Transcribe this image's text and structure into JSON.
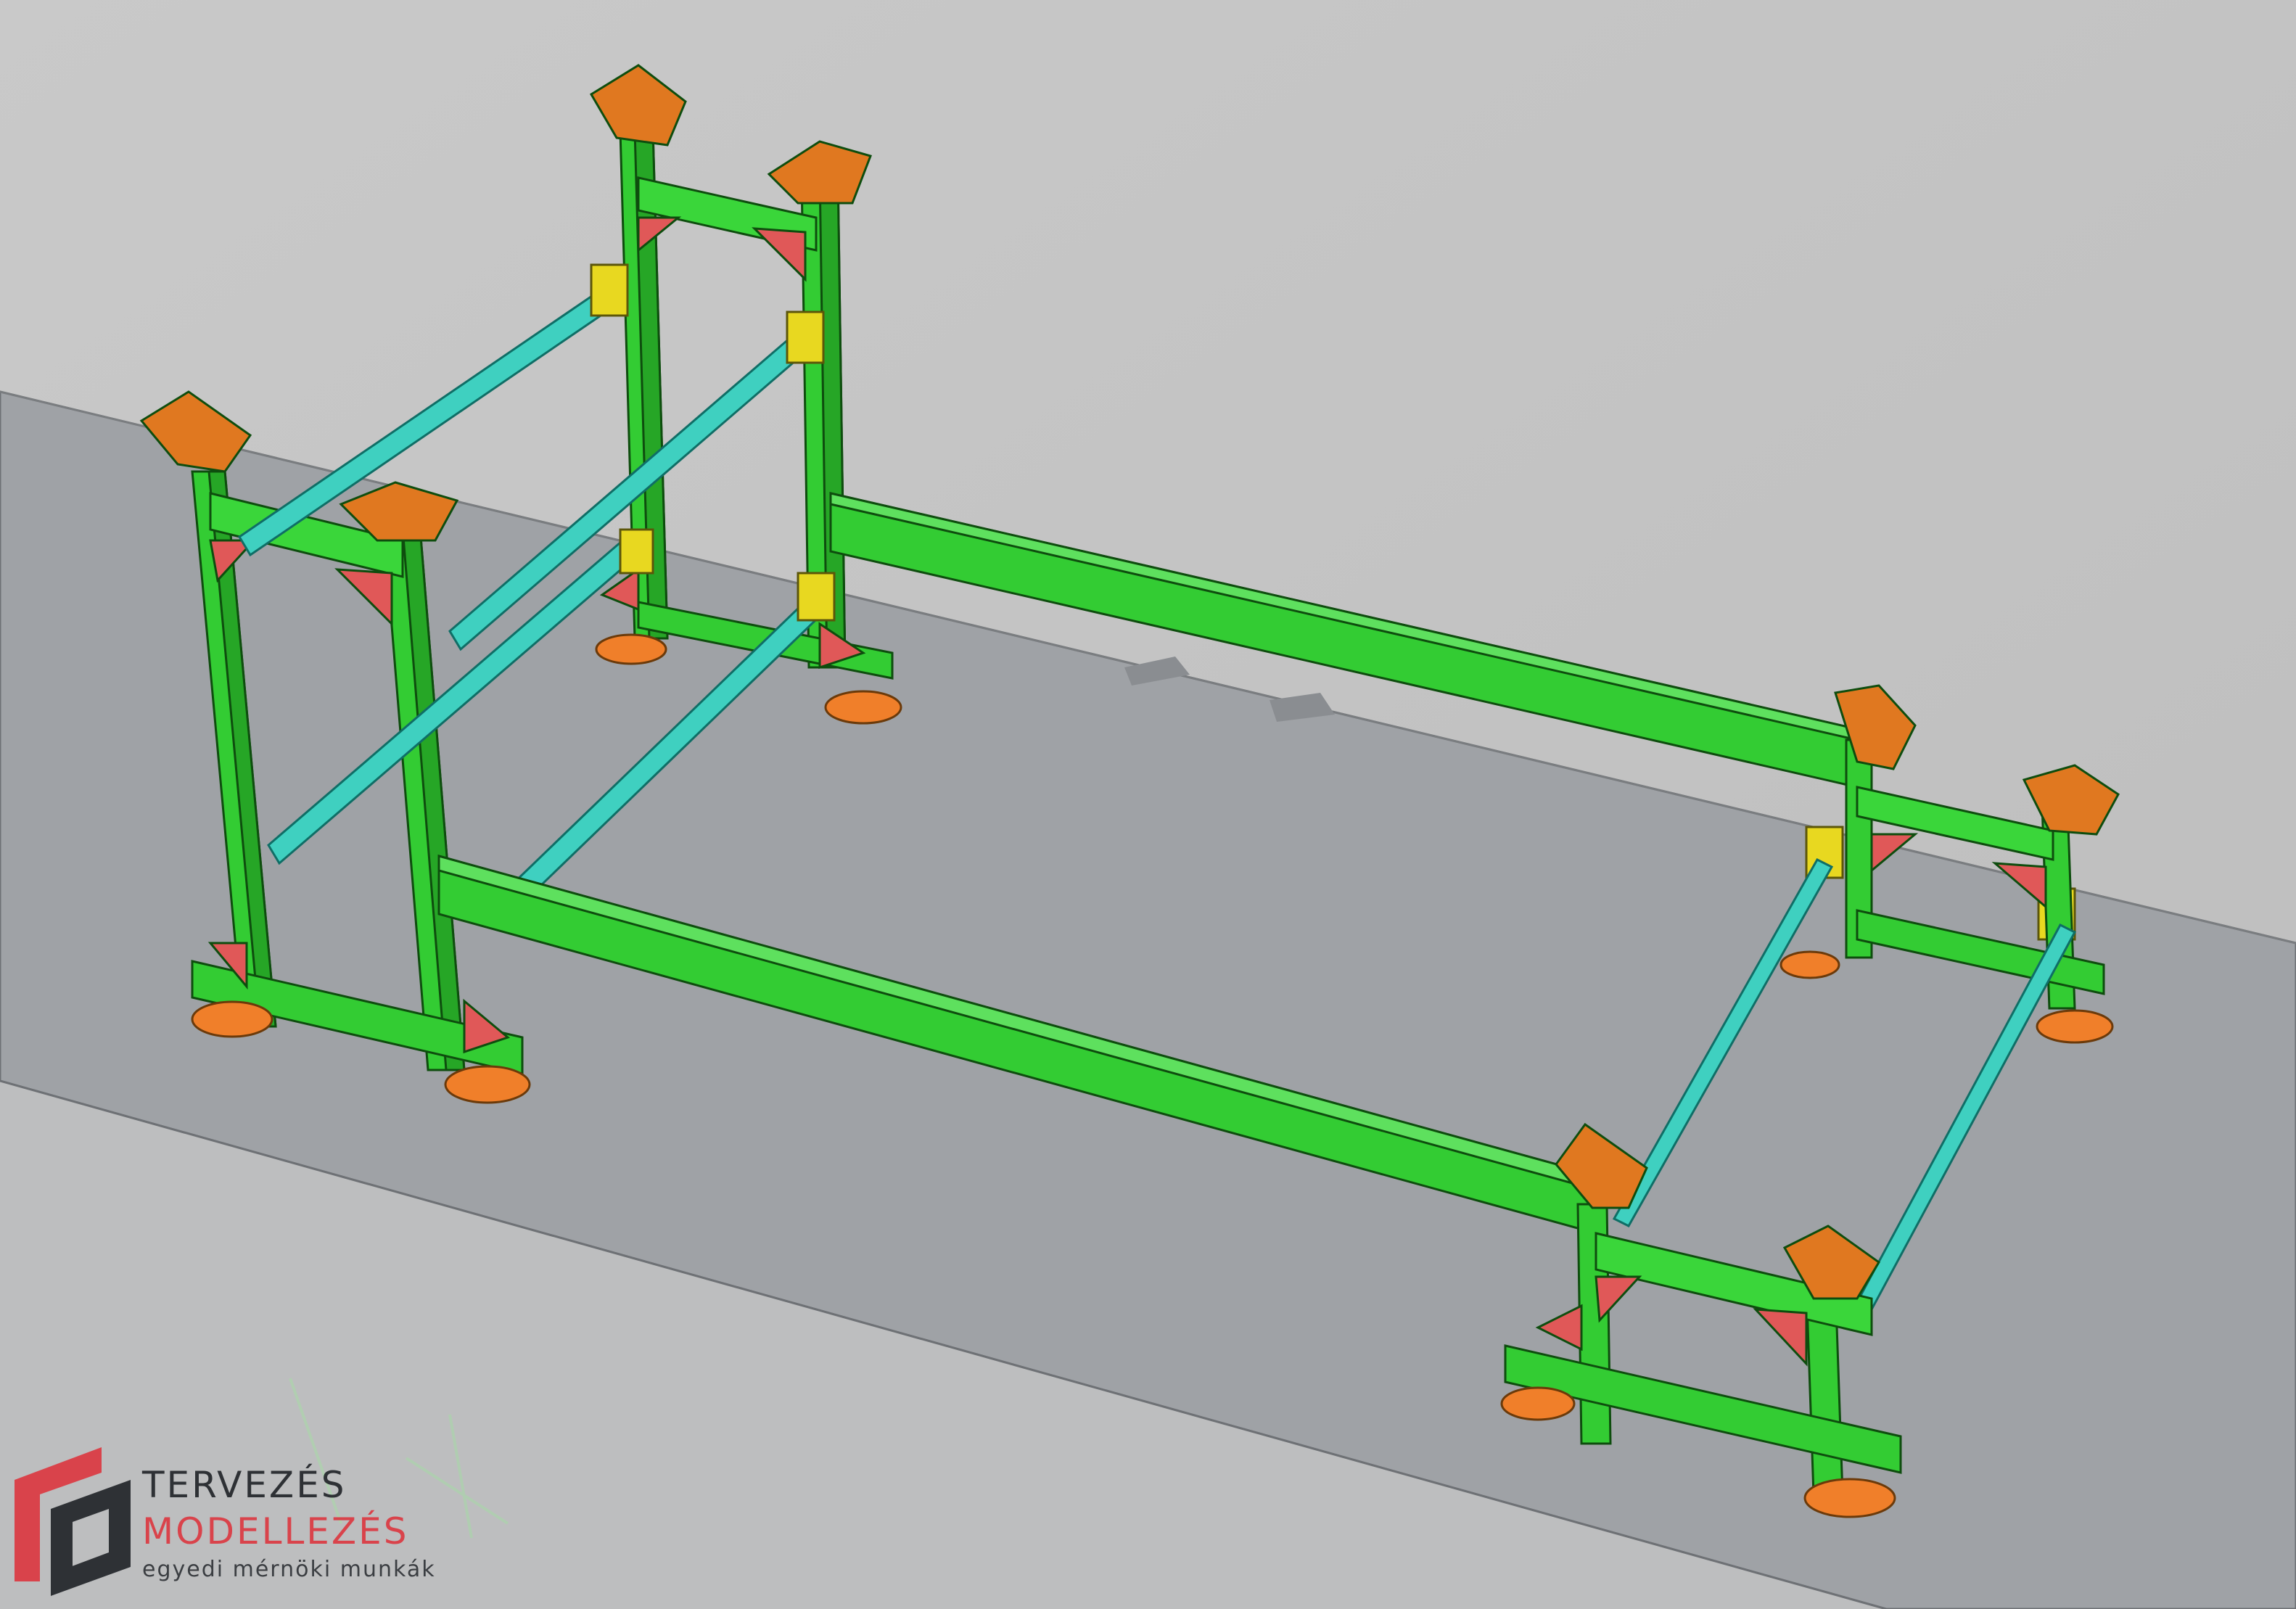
{
  "logo": {
    "line1": "TERVEZÉS",
    "line2": "MODELLEZÉS",
    "line3": "egyedi mérnöki munkák"
  },
  "colors": {
    "background": "#c4c4c4",
    "floor": "#9fa2a6",
    "floor_side": "#8f9296",
    "frame_green": "#33cc33",
    "frame_dark": "#1e8a1e",
    "rail_cyan": "#3fd0c0",
    "plate_orange": "#e07820",
    "gusset_red": "#e05858",
    "bracket_yellow": "#e8d820",
    "foot_orange": "#f07f2a",
    "logo_red": "#d9434b",
    "logo_dark": "#2e3135"
  }
}
